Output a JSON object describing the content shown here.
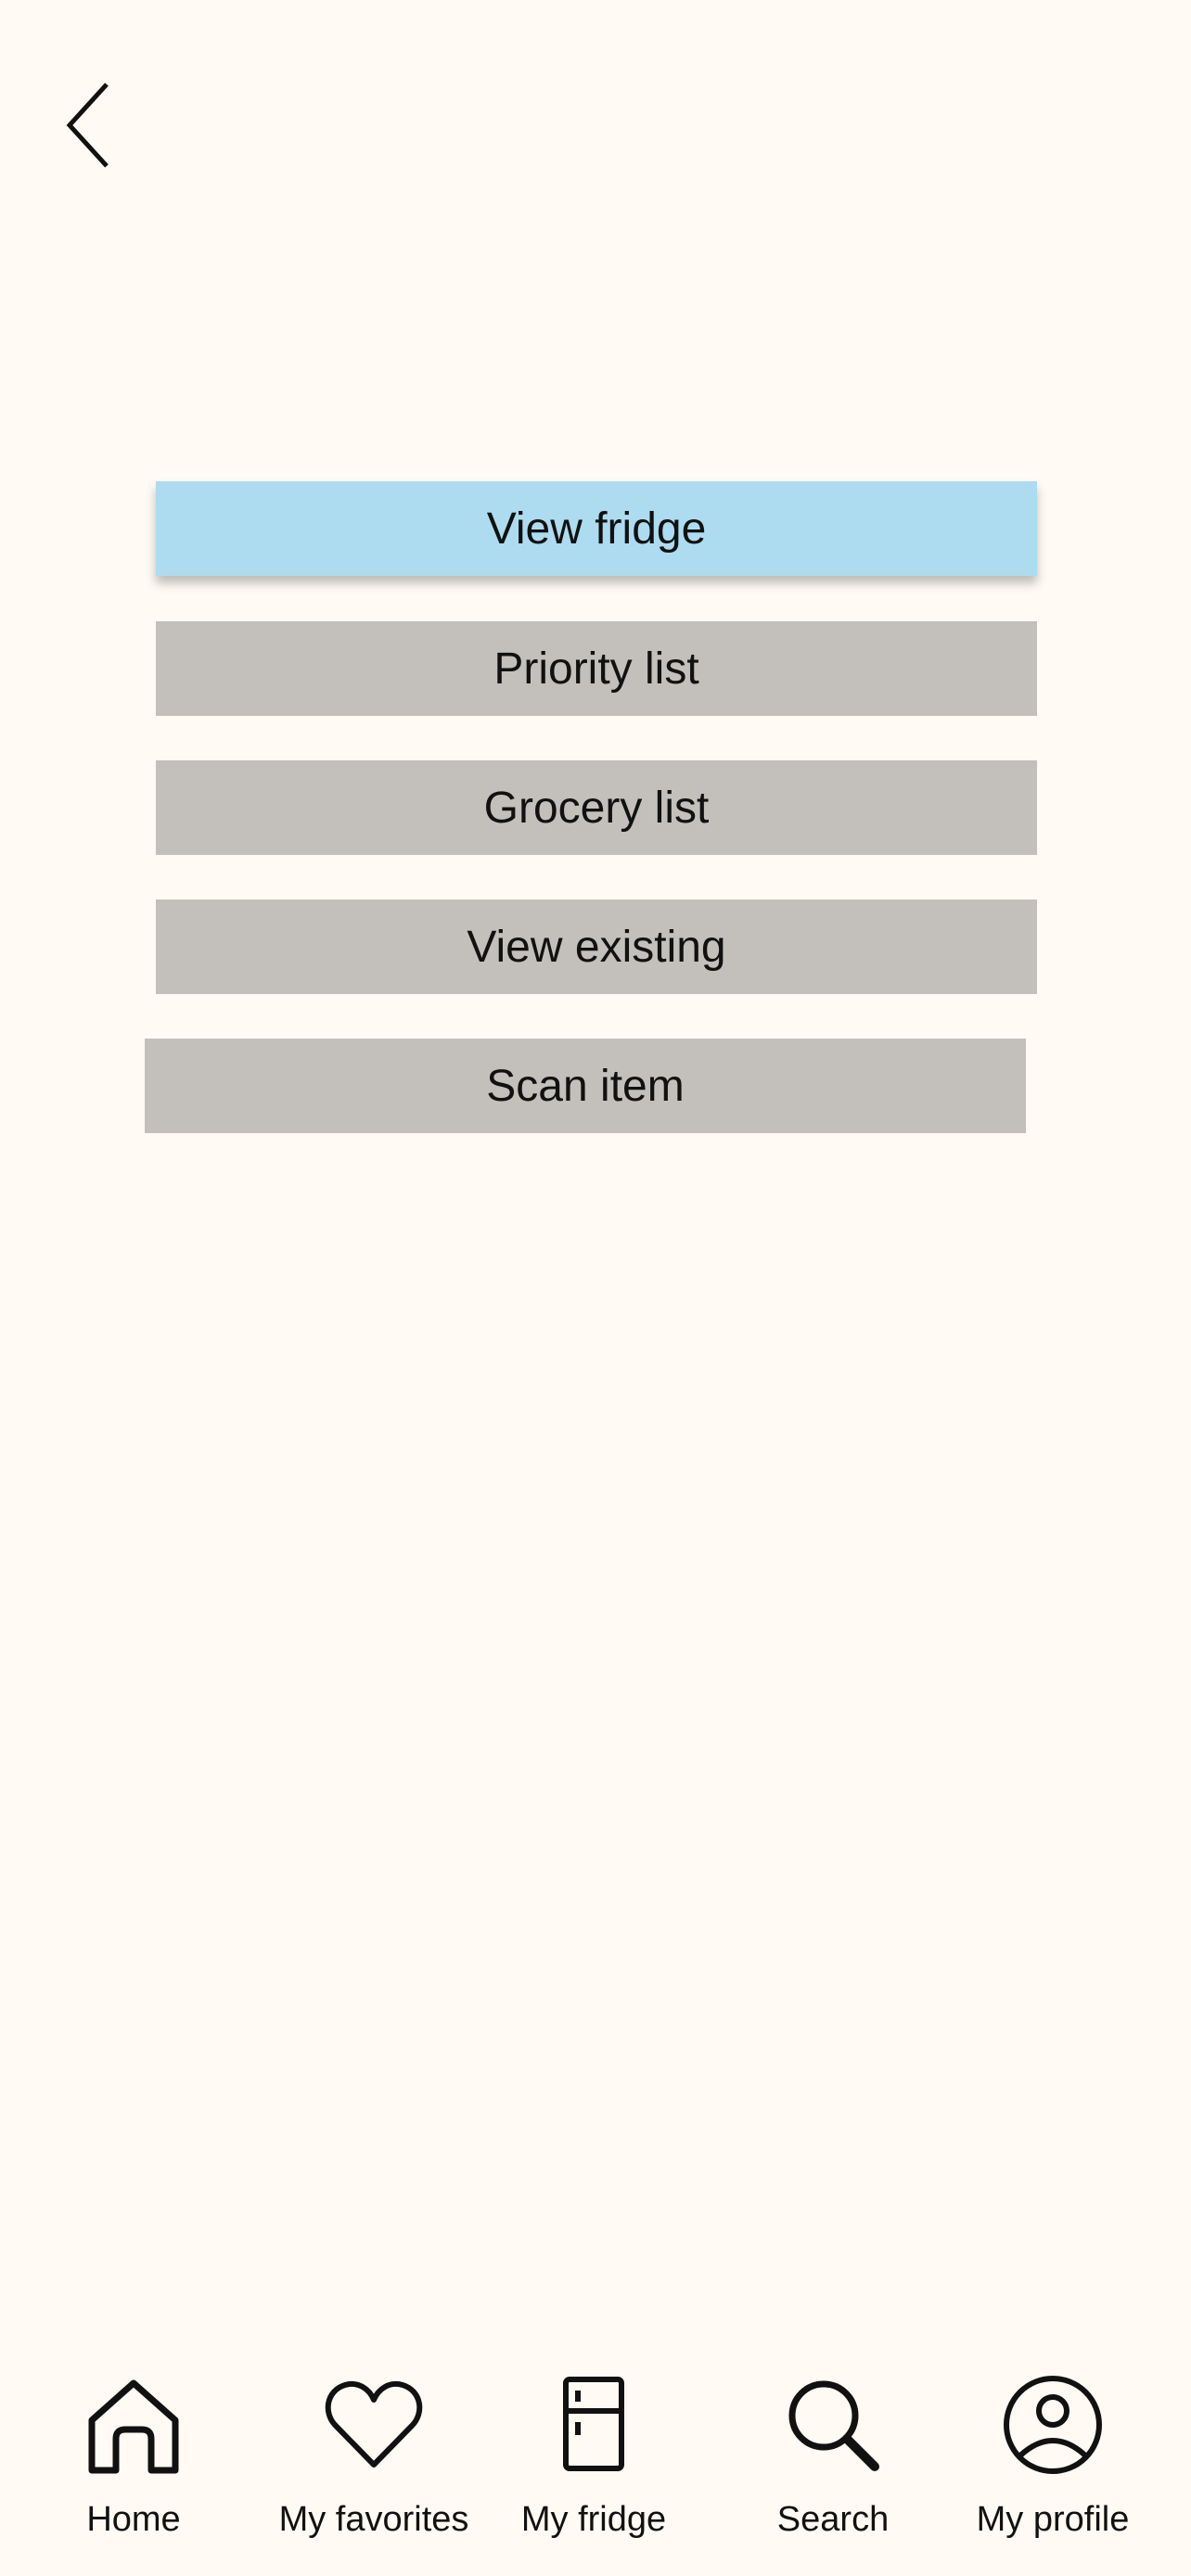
{
  "header": {
    "back_icon": "chevron-left-icon"
  },
  "menu": {
    "active_color": "#ADDCF0",
    "inactive_color": "#C3C0BB",
    "items": [
      {
        "label": "View fridge",
        "active": true
      },
      {
        "label": "Priority list",
        "active": false
      },
      {
        "label": "Grocery list",
        "active": false
      },
      {
        "label": "View existing",
        "active": false
      },
      {
        "label": "Scan item",
        "active": false
      }
    ]
  },
  "bottom_nav": {
    "items": [
      {
        "label": "Home",
        "icon": "home-icon"
      },
      {
        "label": "My favorites",
        "icon": "heart-icon"
      },
      {
        "label": "My fridge",
        "icon": "fridge-icon"
      },
      {
        "label": "Search",
        "icon": "search-icon"
      },
      {
        "label": "My profile",
        "icon": "profile-icon"
      }
    ]
  }
}
